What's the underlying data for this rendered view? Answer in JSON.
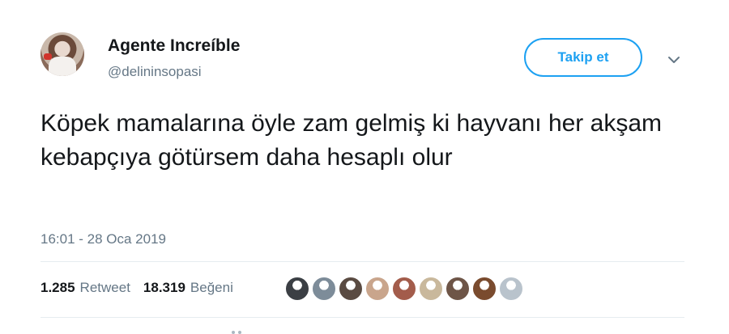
{
  "tweet": {
    "display_name": "Agente Increíble",
    "username": "@delininsopasi",
    "follow_label": "Takip et",
    "text": "Köpek mamalarına öyle zam gelmiş ki hayvanı her akşam kebapçıya götürsem daha hesaplı olur",
    "timestamp": "16:01 - 28 Oca 2019",
    "stats": {
      "retweet_count": "1.285",
      "retweet_label": "Retweet",
      "like_count": "18.319",
      "like_label": "Beğeni"
    },
    "likers": [
      {
        "name": "liker-avatar-1",
        "color": "#3b3f44"
      },
      {
        "name": "liker-avatar-2",
        "color": "#7d8c99"
      },
      {
        "name": "liker-avatar-3",
        "color": "#5a4b42"
      },
      {
        "name": "liker-avatar-4",
        "color": "#c9a58c"
      },
      {
        "name": "liker-avatar-5",
        "color": "#a35c4b"
      },
      {
        "name": "liker-avatar-6",
        "color": "#c9b89c"
      },
      {
        "name": "liker-avatar-7",
        "color": "#6e5547"
      },
      {
        "name": "liker-avatar-8",
        "color": "#7a4b2e"
      },
      {
        "name": "liker-avatar-9",
        "color": "#b9c3cc"
      }
    ]
  },
  "colors": {
    "accent": "#1da1f2",
    "text": "#14171a",
    "muted": "#657786",
    "divider": "#e6ecf0"
  }
}
